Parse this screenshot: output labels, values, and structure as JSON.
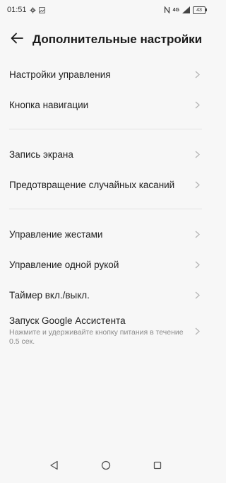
{
  "status_bar": {
    "time": "01:51",
    "left_icons": [
      "gear-icon",
      "image-icon"
    ],
    "right_icons": [
      "nfc-icon",
      "network-4g-icon",
      "signal-icon",
      "battery-icon"
    ],
    "network_label": "4G",
    "battery_level": "43"
  },
  "header": {
    "title": "Дополнительные настройки"
  },
  "groups": [
    {
      "items": [
        {
          "label": "Настройки управления"
        },
        {
          "label": "Кнопка навигации"
        }
      ]
    },
    {
      "items": [
        {
          "label": "Запись экрана"
        },
        {
          "label": "Предотвращение случайных касаний"
        }
      ]
    },
    {
      "items": [
        {
          "label": "Управление жестами"
        },
        {
          "label": "Управление одной рукой"
        },
        {
          "label": "Таймер вкл./выкл."
        },
        {
          "label": "Запуск Google Ассистента",
          "sublabel": "Нажмите и удерживайте кнопку питания в течение 0.5 сек."
        }
      ]
    }
  ],
  "nav": {
    "buttons": [
      "back-triangle-icon",
      "home-circle-icon",
      "recents-square-icon"
    ]
  }
}
